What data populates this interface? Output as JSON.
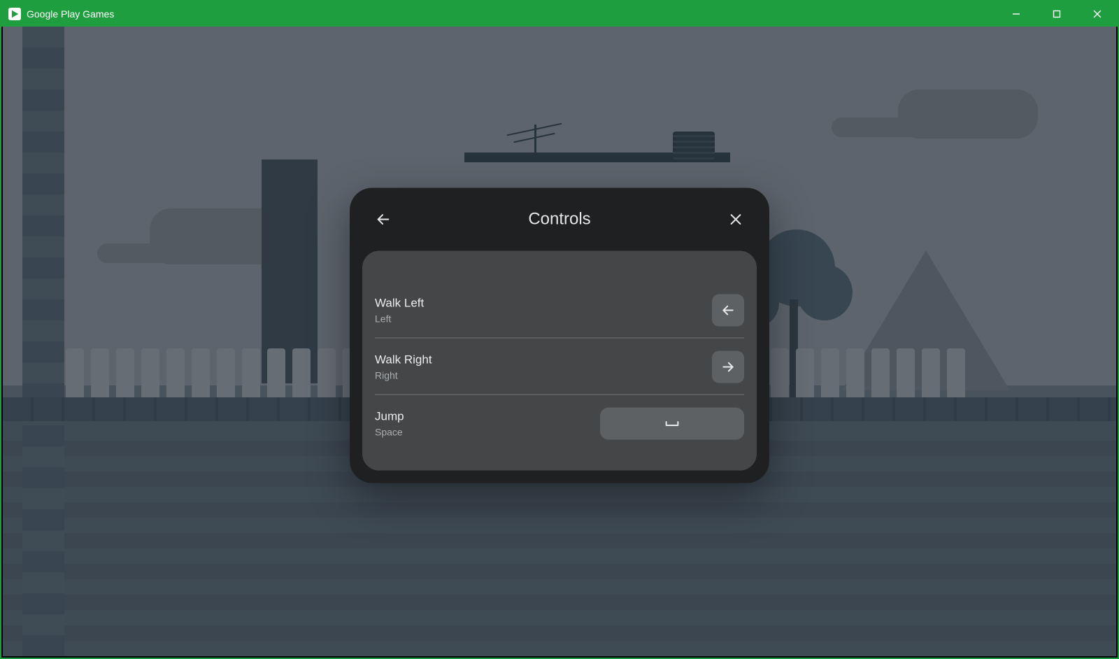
{
  "window": {
    "title": "Google Play Games"
  },
  "modal": {
    "title": "Controls",
    "controls": [
      {
        "action": "Walk Left",
        "key": "Left",
        "icon": "arrow-left"
      },
      {
        "action": "Walk Right",
        "key": "Right",
        "icon": "arrow-right"
      },
      {
        "action": "Jump",
        "key": "Space",
        "icon": "space-bar"
      }
    ]
  }
}
